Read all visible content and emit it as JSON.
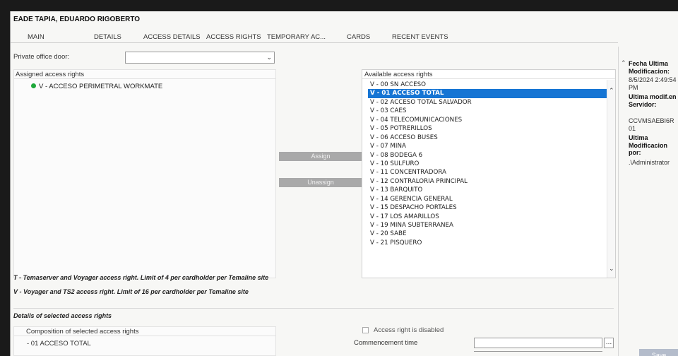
{
  "title": "EADE TAPIA, EDUARDO RIGOBERTO",
  "tabs": [
    "MAIN",
    "DETAILS",
    "ACCESS DETAILS",
    "ACCESS RIGHTS",
    "TEMPORARY AC...",
    "CARDS",
    "RECENT EVENTS"
  ],
  "private_office": {
    "label": "Private office door:",
    "value": ""
  },
  "assigned": {
    "header": "Assigned access rights",
    "items": [
      "V - ACCESO PERIMETRAL WORKMATE"
    ],
    "status_color": "#1ea83a"
  },
  "buttons": {
    "assign": "Assign",
    "unassign": "Unassign"
  },
  "available": {
    "header": "Available access rights",
    "selected": "V - 01 ACCESO TOTAL",
    "items": [
      "V - 00 SN ACCESO",
      "V - 01 ACCESO TOTAL",
      "V - 02 ACCESO TOTAL SALVADOR",
      "V - 03 CAES",
      "V - 04 TELECOMUNICACIONES",
      "V - 05 POTRERILLOS",
      "V - 06 ACCESO BUSES",
      "V - 07 MINA",
      "V - 08 BODEGA 6",
      "V - 10 SULFURO",
      "V - 11 CONCENTRADORA",
      "V - 12 CONTRALORIA PRINCIPAL",
      "V - 13 BARQUITO",
      "V - 14 GERENCIA GENERAL",
      "V - 15 DESPACHO PORTALES",
      "V - 17 LOS AMARILLOS",
      "V - 19 MINA SUBTERRANEA",
      "V - 20 SABE",
      "V - 21 PISQUERO"
    ]
  },
  "legend": {
    "t": "T - Temaserver and Voyager access right. Limit of 4 per cardholder per Temaline site",
    "v": "V - Voyager and TS2 access right. Limit of 16 per cardholder per Temaline site"
  },
  "details": {
    "title": "Details of selected access rights",
    "composition_header": "Composition of selected access rights",
    "composition_items": [
      "- 01 ACCESO TOTAL"
    ],
    "disabled_label": "Access right is disabled",
    "commencement_label": "Commencement time",
    "commencement_value": ""
  },
  "sidebar": {
    "fecha_label": "Fecha Ultima Modificacion:",
    "fecha_value": "8/5/2024 2:49:54 PM",
    "server_label": "Ultima modif.en Servidor:",
    "server_value": "CCVMSAEBI6R 01",
    "por_label": "Ultima Modificacion por:",
    "por_value": ".\\Administrator"
  },
  "save_label": "Save",
  "colors": {
    "selection": "#1675d4",
    "button": "#a9a9a9",
    "save": "#b4bccb"
  }
}
